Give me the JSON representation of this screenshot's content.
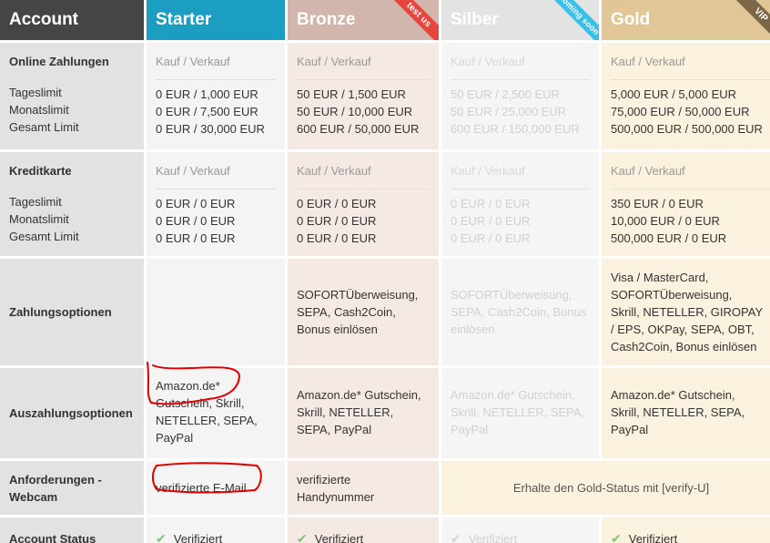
{
  "header": {
    "account": "Account",
    "starter": "Starter",
    "bronze": "Bronze",
    "silber": "Silber",
    "gold": "Gold",
    "ribbons": {
      "bronze": "test us",
      "silber": "coming soon",
      "gold": "VIP"
    }
  },
  "labels": {
    "online": "Online Zahlungen",
    "kredit": "Kreditkarte",
    "limits": [
      "Tageslimit",
      "Monatslimit",
      "Gesamt Limit"
    ],
    "zahlungsoptionen": "Zahlungsoptionen",
    "auszahlungsoptionen": "Auszahlungsoptionen",
    "anforderungen": "Anforderungen - Webcam",
    "status": "Account Status"
  },
  "mode": "Kauf / Verkauf",
  "online": {
    "starter": [
      "0 EUR / 1,000 EUR",
      "0 EUR / 7,500 EUR",
      "0 EUR / 30,000 EUR"
    ],
    "bronze": [
      "50 EUR / 1,500 EUR",
      "50 EUR / 10,000 EUR",
      "600 EUR / 50,000 EUR"
    ],
    "silber": [
      "50 EUR / 2,500 EUR",
      "50 EUR / 25,000 EUR",
      "600 EUR / 150,000 EUR"
    ],
    "gold": [
      "5,000 EUR / 5,000 EUR",
      "75,000 EUR / 50,000 EUR",
      "500,000 EUR / 500,000 EUR"
    ]
  },
  "kredit": {
    "starter": [
      "0 EUR / 0 EUR",
      "0 EUR / 0 EUR",
      "0 EUR / 0 EUR"
    ],
    "bronze": [
      "0 EUR / 0 EUR",
      "0 EUR / 0 EUR",
      "0 EUR / 0 EUR"
    ],
    "silber": [
      "0 EUR / 0 EUR",
      "0 EUR / 0 EUR",
      "0 EUR / 0 EUR"
    ],
    "gold": [
      "350 EUR / 0 EUR",
      "10,000 EUR / 0 EUR",
      "500,000 EUR / 0 EUR"
    ]
  },
  "zahlung": {
    "starter": "",
    "bronze": [
      "SOFORTÜberweisung,",
      "SEPA, Cash2Coin,",
      "Bonus einlösen"
    ],
    "silber": [
      "SOFORTÜberweisung,",
      "SEPA, Cash2Coin, Bonus",
      "einlösen"
    ],
    "gold": [
      "Visa / MasterCard,",
      "SOFORTÜberweisung,",
      "Skrill, NETELLER, GIROPAY",
      "/ EPS, OKPay, SEPA, OBT,",
      "Cash2Coin, Bonus einlösen"
    ]
  },
  "auszahlung": {
    "starter": [
      "Amazon.de*",
      "Gutschein, Skrill,",
      "NETELLER, SEPA,",
      "PayPal"
    ],
    "bronze": [
      "Amazon.de* Gutschein,",
      "Skrill, NETELLER,",
      "SEPA, PayPal"
    ],
    "silber": [
      "Amazon.de* Gutschein,",
      "Skrill, NETELLER, SEPA,",
      "PayPal"
    ],
    "gold": [
      "Amazon.de* Gutschein,",
      "Skrill, NETELLER, SEPA,",
      "PayPal"
    ]
  },
  "anforderung": {
    "starter": "verifizierte E-Mail",
    "bronze": [
      "verifizierte",
      "Handynummer"
    ],
    "gold_silber": "Erhalte den Gold-Status mit [verify-U]"
  },
  "status": {
    "label": "Verifiziert",
    "icon": "check-icon"
  },
  "colors": {
    "account_header": "#454545",
    "starter_header": "#1c9ec2",
    "bronze_header": "#d2b6ad",
    "silber_header": "#e3e3e3",
    "gold_header": "#e1c796",
    "check": "#7cc576",
    "annotation": "#e00000"
  }
}
